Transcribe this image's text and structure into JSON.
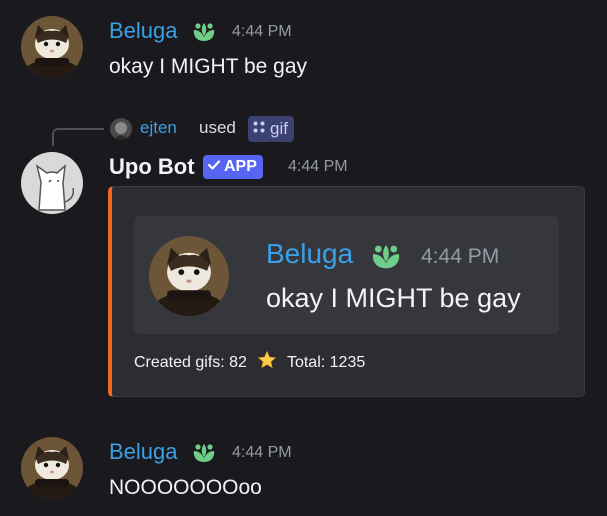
{
  "colors": {
    "background": "#1a1a1e",
    "username_blue": "#3ba0e6",
    "embed_accent": "#f26722",
    "app_badge": "#5865f2",
    "role_icon_green": "#6fcf8a"
  },
  "messages": [
    {
      "author": "Beluga",
      "time": "4:44 PM",
      "text": "okay I MIGHT be gay",
      "role_icon": "lotus-icon"
    },
    {
      "author": "Beluga",
      "time": "4:44 PM",
      "text": "NOOOOOOOoo",
      "role_icon": "lotus-icon"
    }
  ],
  "reply": {
    "user": "ejten",
    "used_label": "used",
    "command": "gif",
    "command_icon": "slash-command-icon"
  },
  "bot": {
    "author": "Upo Bot",
    "badge": "APP",
    "time": "4:44 PM"
  },
  "embed": {
    "quote": {
      "author": "Beluga",
      "time": "4:44 PM",
      "text": "okay I MIGHT be gay"
    },
    "footer": {
      "created_label": "Created gifs: 82",
      "star_icon": "star-icon",
      "total_label": "Total: 1235"
    }
  }
}
